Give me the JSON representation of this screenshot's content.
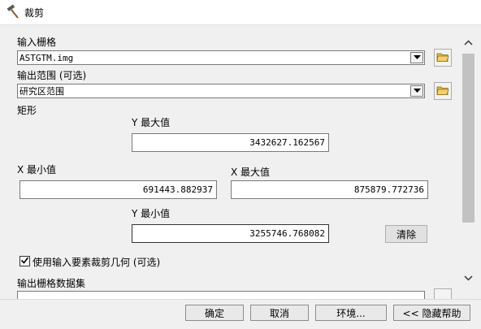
{
  "window": {
    "title": "裁剪",
    "icon": "hammer-icon"
  },
  "form": {
    "input_raster": {
      "label": "输入栅格",
      "value": "ASTGTM.img"
    },
    "output_extent": {
      "label": "输出范围 (可选)",
      "value": "研究区范围"
    },
    "rectangle": {
      "label": "矩形",
      "y_max_label": "Y 最大值",
      "y_max": "3432627.162567",
      "x_min_label": "X 最小值",
      "x_min": "691443.882937",
      "x_max_label": "X 最大值",
      "x_max": "875879.772736",
      "y_min_label": "Y 最小值",
      "y_min": "3255746.768082",
      "clear_label": "清除"
    },
    "use_input_features": {
      "label": "使用输入要素裁剪几何 (可选)",
      "checked": true
    },
    "output_raster": {
      "label": "输出栅格数据集"
    }
  },
  "footer": {
    "ok": "确定",
    "cancel": "取消",
    "environments": "环境...",
    "hide_help": "<< 隐藏帮助"
  }
}
